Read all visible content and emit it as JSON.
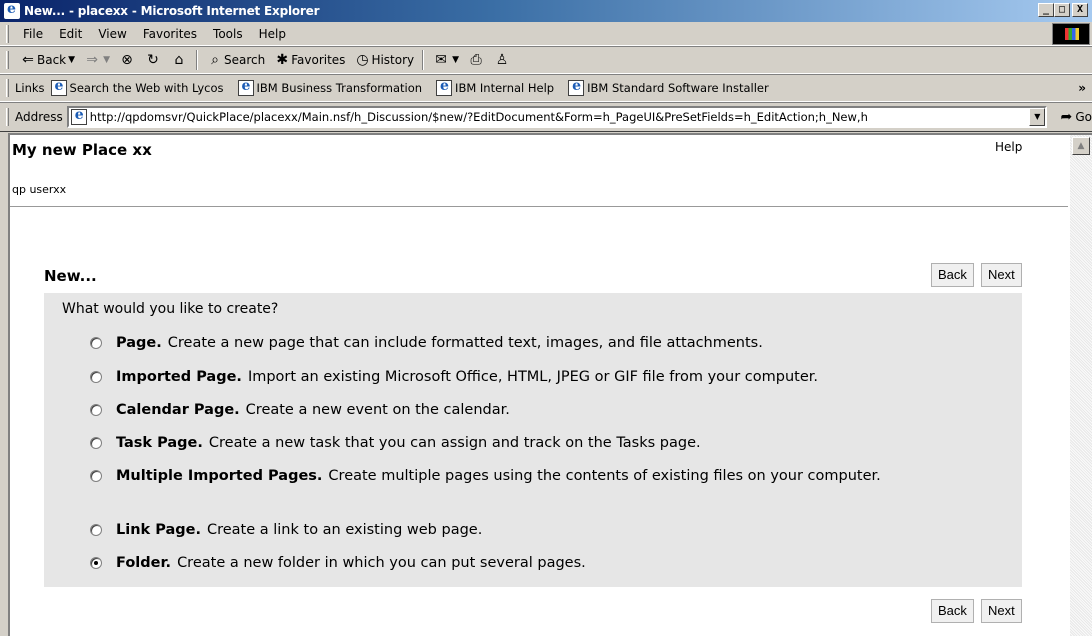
{
  "window": {
    "title": "New... - placexx - Microsoft Internet Explorer",
    "minimize": "_",
    "maximize": "□",
    "close": "X"
  },
  "menu": [
    "File",
    "Edit",
    "View",
    "Favorites",
    "Tools",
    "Help"
  ],
  "toolbar": {
    "back": "Back",
    "search": "Search",
    "favorites": "Favorites",
    "history": "History"
  },
  "links": {
    "label": "Links",
    "items": [
      "Search the Web with Lycos",
      "IBM Business Transformation",
      "IBM Internal Help",
      "IBM Standard Software Installer"
    ],
    "more": "»"
  },
  "address": {
    "label": "Address",
    "url": "http://qpdomsvr/QuickPlace/placexx/Main.nsf/h_Discussion/$new/?EditDocument&Form=h_PageUI&PreSetFields=h_EditAction;h_New,h",
    "go": "Go"
  },
  "page": {
    "place_title": "My new Place xx",
    "help": "Help",
    "user": "qp userxx",
    "section_title": "New...",
    "back_button": "Back",
    "next_button": "Next",
    "question": "What would you like to create?",
    "options": [
      {
        "title": "Page.",
        "text": "Create a new page that can include formatted text, images, and file attachments.",
        "checked": false
      },
      {
        "title": "Imported Page.",
        "text": "Import an existing Microsoft Office, HTML, JPEG or GIF file from your computer.",
        "checked": false
      },
      {
        "title": "Calendar Page.",
        "text": "Create a new event on the calendar.",
        "checked": false
      },
      {
        "title": "Task Page.",
        "text": "Create a new task that you can assign and track on the Tasks page.",
        "checked": false
      },
      {
        "title": "Multiple Imported Pages.",
        "text": "Create multiple pages using the contents of existing files on your computer.",
        "checked": false
      },
      {
        "title": "Link Page.",
        "text": "Create a link to an existing web page.",
        "checked": false
      },
      {
        "title": "Folder.",
        "text": "Create a new folder in which you can put several pages.",
        "checked": true
      }
    ]
  }
}
